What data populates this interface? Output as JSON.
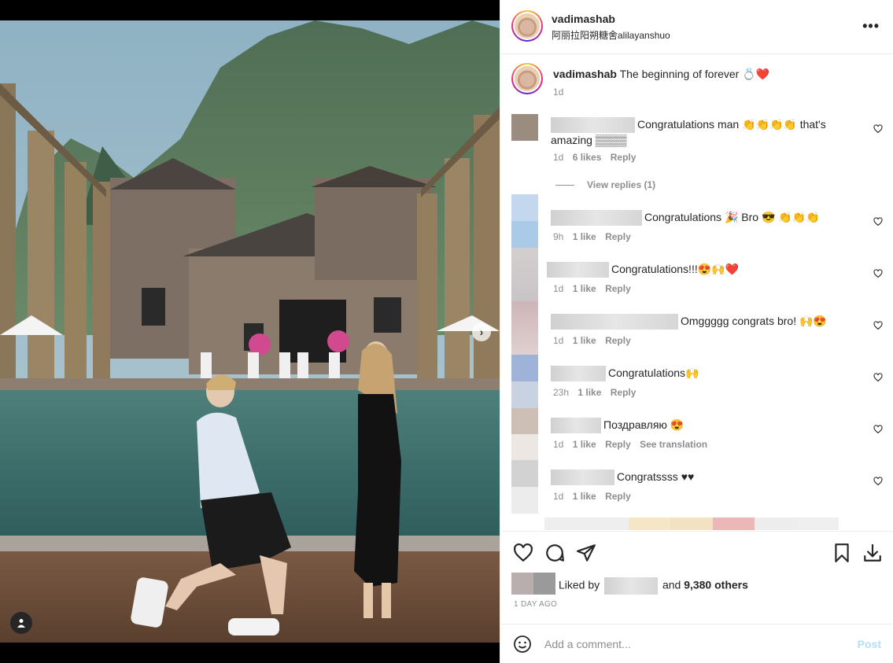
{
  "post": {
    "author": "vadimashab",
    "location": "阿丽拉阳朔糖舍alilayanshuo",
    "caption_text": "The beginning of forever 💍❤️",
    "caption_time": "1d"
  },
  "comments": [
    {
      "text": "Congratulations man 👏👏👏👏 that's amazing ▒▒▒▒",
      "time": "1d",
      "likes": "6 likes",
      "reply": "Reply",
      "view_replies": "View replies (1)"
    },
    {
      "text": "Congratulations 🎉 Bro 😎 👏👏👏",
      "time": "9h",
      "likes": "1 like",
      "reply": "Reply"
    },
    {
      "text": "Congratulations!!!😍🙌❤️",
      "time": "1d",
      "likes": "1 like",
      "reply": "Reply"
    },
    {
      "text": "Omggggg congrats bro! 🙌😍",
      "time": "1d",
      "likes": "1 like",
      "reply": "Reply"
    },
    {
      "text": "Congratulations🙌",
      "time": "23h",
      "likes": "1 like",
      "reply": "Reply"
    },
    {
      "text": "Поздравляю 😍",
      "time": "1d",
      "likes": "1 like",
      "reply": "Reply",
      "translate": "See translation"
    },
    {
      "text": "Congratssss ♥♥",
      "time": "1d",
      "likes": "1 like",
      "reply": "Reply"
    }
  ],
  "likes": {
    "prefix": "Liked by",
    "and": "and",
    "others": "9,380 others"
  },
  "posted_ago": "1 DAY AGO",
  "composer": {
    "placeholder": "Add a comment...",
    "post_label": "Post"
  },
  "colors": {
    "text": "#262626",
    "muted": "#8e8e8e",
    "post_button_disabled": "#b2dffc",
    "border": "#efefef"
  },
  "icons": {
    "like": "heart-icon",
    "comment": "comment-icon",
    "share": "paper-plane-icon",
    "save": "bookmark-icon",
    "download": "download-icon",
    "more": "more-options-icon",
    "emoji": "emoji-icon",
    "next": "chevron-right-icon",
    "tagged": "user-tag-icon"
  }
}
